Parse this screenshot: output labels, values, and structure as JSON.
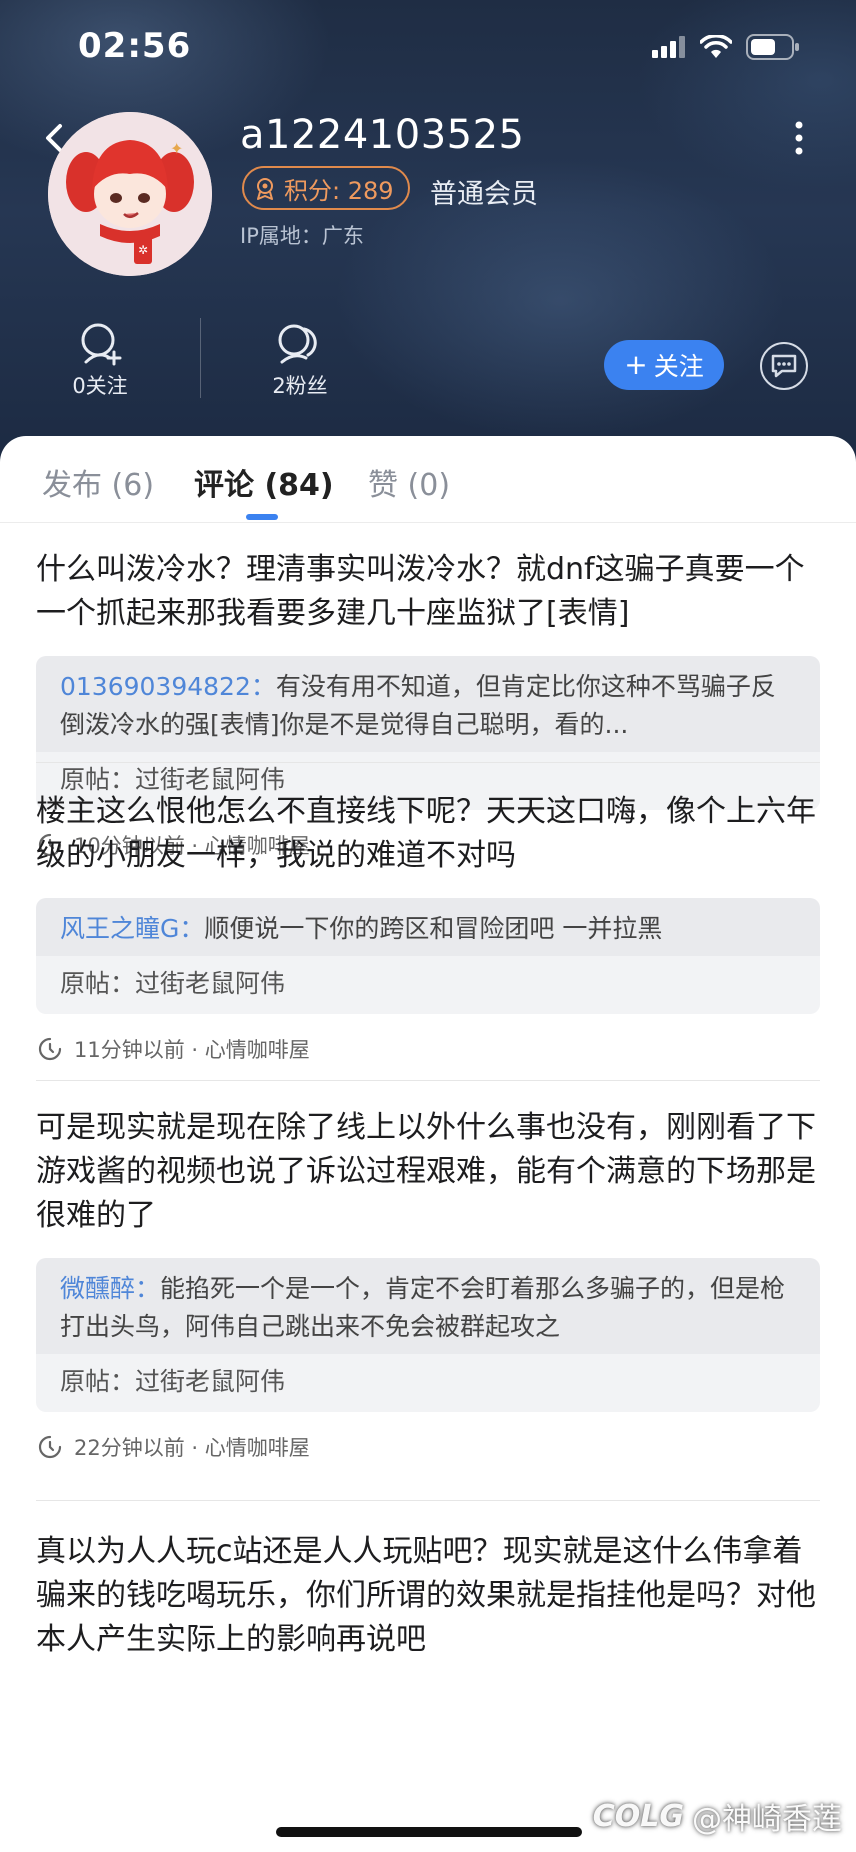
{
  "status_bar": {
    "time": "02:56"
  },
  "profile": {
    "username": "a1224103525",
    "points_label": "积分: 289",
    "member_level": "普通会员",
    "ip_location": "IP属地：广东",
    "following": "0关注",
    "fans": "2粉丝",
    "follow_button_label": "关注"
  },
  "tabs": [
    {
      "label": "发布 (6)",
      "active": false
    },
    {
      "label": "评论 (84)",
      "active": true
    },
    {
      "label": "赞 (0)",
      "active": false
    }
  ],
  "comments": [
    {
      "text": "什么叫泼冷水？理清事实叫泼冷水？就dnf这骗子真要一个一个抓起来那我看要多建几十座监狱了[表情]",
      "reply_author": "013690394822：",
      "reply_text": "有没有用不知道，但肯定比你这种不骂骗子反倒泼冷水的强[表情]你是不是觉得自己聪明，看的...",
      "origin": "原帖：过街老鼠阿伟",
      "meta": "10分钟以前 · 心情咖啡屋"
    },
    {
      "text": "楼主这么恨他怎么不直接线下呢？天天这口嗨，像个上六年级的小朋友一样，我说的难道不对吗",
      "reply_author": "风王之瞳G：",
      "reply_text": "顺便说一下你的跨区和冒险团吧 一并拉黑",
      "origin": "原帖：过街老鼠阿伟",
      "meta": "11分钟以前 · 心情咖啡屋"
    },
    {
      "text": "可是现实就是现在除了线上以外什么事也没有，刚刚看了下游戏酱的视频也说了诉讼过程艰难，能有个满意的下场那是很难的了",
      "reply_author": "微醺醉：",
      "reply_text": "能掐死一个是一个，肯定不会盯着那么多骗子的，但是枪打出头鸟，阿伟自己跳出来不免会被群起攻之",
      "origin": "原帖：过街老鼠阿伟",
      "meta": "22分钟以前 · 心情咖啡屋"
    },
    {
      "text": "真以为人人玩c站还是人人玩贴吧？现实就是这什么伟拿着骗来的钱吃喝玩乐，你们所谓的效果就是指挂他是吗？对他本人产生实际上的影响再说吧"
    }
  ],
  "watermark": "@神崎香莲",
  "watermark_logo": "COLG",
  "colors": {
    "accent": "#3b82f0",
    "points": "#ef9a5e",
    "reply_author": "#4f86d8",
    "header_bg": "#22324c"
  }
}
